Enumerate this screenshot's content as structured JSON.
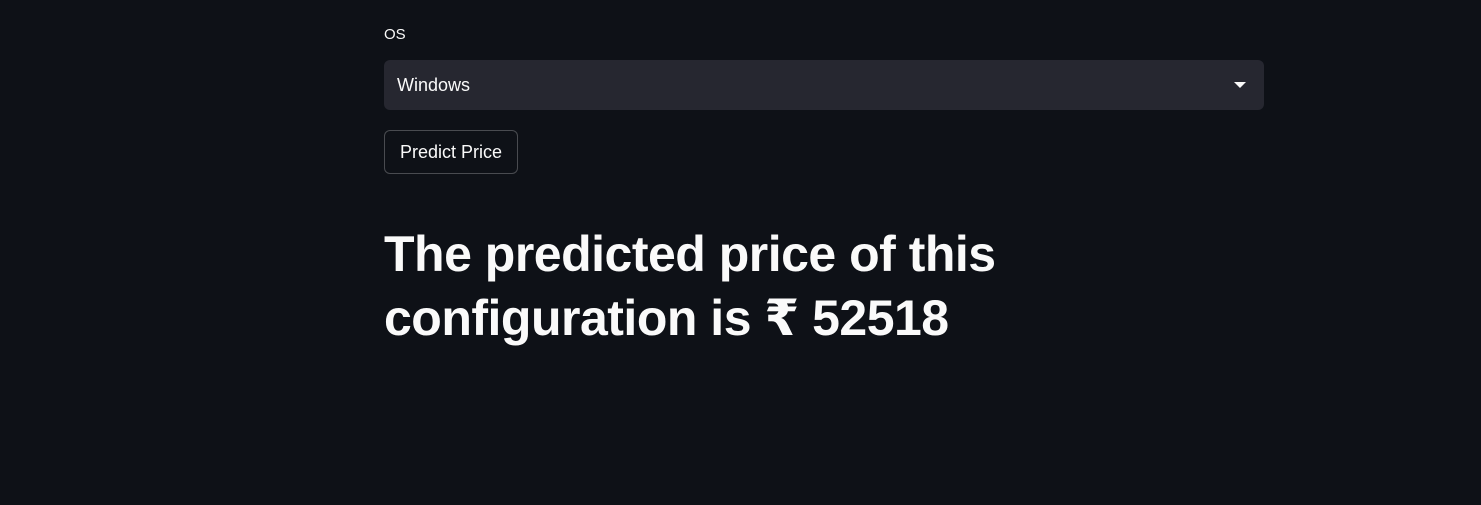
{
  "os_field": {
    "label": "OS",
    "selected_value": "Windows",
    "icon": "chevron-down-icon"
  },
  "predict_button": {
    "label": "Predict Price"
  },
  "result": {
    "text": "The predicted price of this configuration is ₹ 52518"
  },
  "colors": {
    "background": "#0e1117",
    "select_background": "#262730",
    "text": "#fafafa"
  }
}
